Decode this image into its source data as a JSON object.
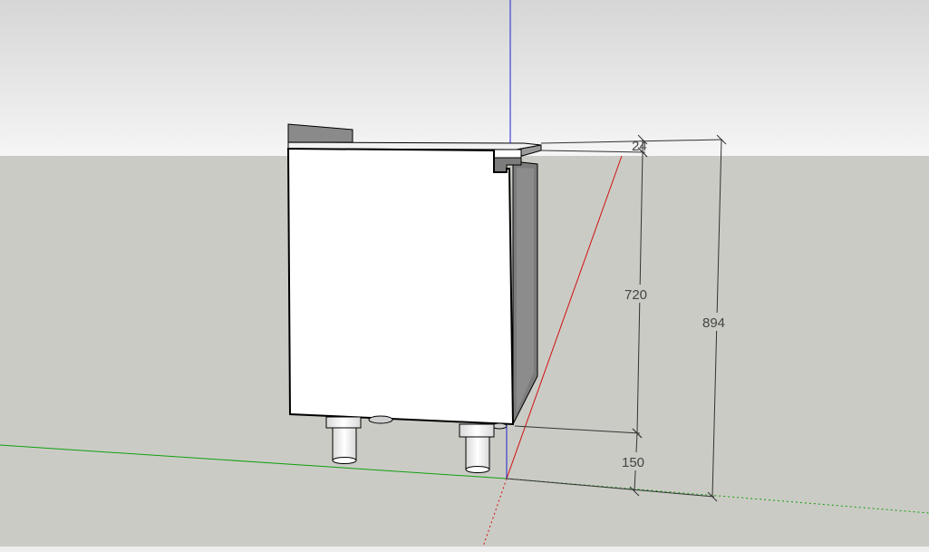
{
  "dimensions": {
    "top_overhang": "24",
    "cabinet_height": "720",
    "legs_height": "150",
    "total_height": "894"
  },
  "colors": {
    "sky_top": "#d7d7d7",
    "sky_bottom": "#f4f4f4",
    "ground": "#cbcbc5",
    "cabinet_face": "#ffffff",
    "cabinet_shadow": "#7c7c7c",
    "edge": "#000000",
    "axis_red": "#d01010",
    "axis_green": "#10a010",
    "axis_blue": "#2020d0",
    "dimension_line": "#333333"
  }
}
